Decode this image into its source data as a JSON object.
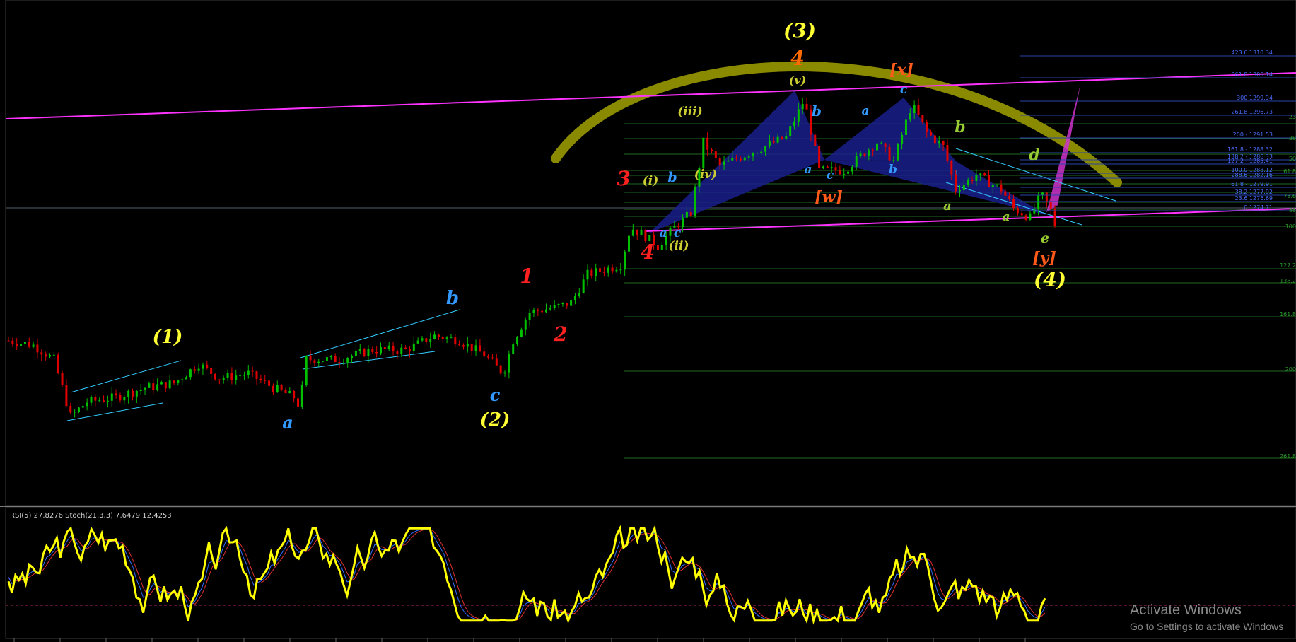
{
  "colors": {
    "background": "#000000",
    "bull_candle": "#00c000",
    "bear_candle": "#e00000",
    "channel_line": "#ff33ff",
    "arc": "#8a8a00",
    "pattern_fill": "#1a1f8c",
    "fib_line": "#2a44aa",
    "fib_text": "#4a6cff",
    "grid_green": "#1f6a1f",
    "rsi": "#ffff00",
    "stoch_main": "#2f6cff",
    "stoch_signal": "#e03030"
  },
  "indicator": {
    "label": "RSI(5) 27.8276  Stoch(21,3,3) 7.6479 12.4253"
  },
  "watermark": {
    "line1": "Activate Windows",
    "line2": "Go to Settings to activate Windows"
  },
  "wave_labels": [
    {
      "text": "(1)",
      "color": "#ffff33",
      "size": 26
    },
    {
      "text": "a",
      "color": "#3399ff",
      "size": 24
    },
    {
      "text": "b",
      "color": "#3399ff",
      "size": 26
    },
    {
      "text": "c",
      "color": "#3399ff",
      "size": 24
    },
    {
      "text": "(2)",
      "color": "#ffff33",
      "size": 26
    },
    {
      "text": "1",
      "color": "#ff2020",
      "size": 28
    },
    {
      "text": "2",
      "color": "#ff2020",
      "size": 28
    },
    {
      "text": "3",
      "color": "#ff2020",
      "size": 28
    },
    {
      "text": "4",
      "color": "#ff2020",
      "size": 28
    },
    {
      "text": "(i)",
      "color": "#cccc33",
      "size": 17
    },
    {
      "text": "(ii)",
      "color": "#cccc33",
      "size": 17
    },
    {
      "text": "(iii)",
      "color": "#cccc33",
      "size": 17
    },
    {
      "text": "(iv)",
      "color": "#cccc33",
      "size": 17
    },
    {
      "text": "(v)",
      "color": "#cccc33",
      "size": 16
    },
    {
      "text": "a",
      "color": "#3399ff",
      "size": 17
    },
    {
      "text": "b",
      "color": "#3399ff",
      "size": 19
    },
    {
      "text": "c",
      "color": "#3399ff",
      "size": 17
    },
    {
      "text": "(3)",
      "color": "#ffff33",
      "size": 28
    },
    {
      "text": "4",
      "color": "#ff6a00",
      "size": 28
    },
    {
      "text": "a",
      "color": "#3399ff",
      "size": 17
    },
    {
      "text": "b",
      "color": "#3399ff",
      "size": 20
    },
    {
      "text": "c",
      "color": "#3399ff",
      "size": 17
    },
    {
      "text": "[w]",
      "color": "#ff5a1a",
      "size": 22
    },
    {
      "text": "[x]",
      "color": "#ff5a1a",
      "size": 22
    },
    {
      "text": "a",
      "color": "#3399ff",
      "size": 17
    },
    {
      "text": "b",
      "color": "#3399ff",
      "size": 17
    },
    {
      "text": "c",
      "color": "#3399ff",
      "size": 17
    },
    {
      "text": "a",
      "color": "#99cc33",
      "size": 18
    },
    {
      "text": "b",
      "color": "#99cc33",
      "size": 22
    },
    {
      "text": "a",
      "color": "#99cc33",
      "size": 17
    },
    {
      "text": "d",
      "color": "#99cc33",
      "size": 22
    },
    {
      "text": "e",
      "color": "#99cc33",
      "size": 19
    },
    {
      "text": "[y]",
      "color": "#ff5a1a",
      "size": 22
    },
    {
      "text": "(4)",
      "color": "#ffff33",
      "size": 28
    }
  ],
  "fib_levels": [
    {
      "label": "423.6 1310.34"
    },
    {
      "label": "361.8 1305.14"
    },
    {
      "label": "300 1299.94"
    },
    {
      "label": "261.8 1296.73"
    },
    {
      "label": "200 - 1291.53"
    },
    {
      "label": "161.8 - 1288.32"
    },
    {
      "label": "138.2 - 1286.33"
    },
    {
      "label": "127.2 - 1285.41"
    },
    {
      "label": "100.0 1283.12"
    },
    {
      "label": "288.6 1282.16"
    },
    {
      "label": "61.8 - 1279.91"
    },
    {
      "label": "38.2 1277.92"
    },
    {
      "label": "23.6 1276.69"
    },
    {
      "label": "0 1274.71"
    }
  ],
  "right_edge_labels": [
    {
      "text": "23"
    },
    {
      "text": "38"
    },
    {
      "text": "50"
    },
    {
      "text": "61.8"
    },
    {
      "text": "78.6"
    },
    {
      "text": "88"
    },
    {
      "text": "100"
    },
    {
      "text": "127.2"
    },
    {
      "text": "138.2"
    },
    {
      "text": "161.8"
    },
    {
      "text": "200"
    },
    {
      "text": "261.8"
    }
  ],
  "chart_data": {
    "type": "candlestick",
    "price_path": [
      {
        "x": 0,
        "y": 1268.0
      },
      {
        "x": 30,
        "y": 1267.5
      },
      {
        "x": 55,
        "y": 1266.0
      },
      {
        "x": 75,
        "y": 1260.0
      },
      {
        "x": 95,
        "y": 1261.5
      },
      {
        "x": 130,
        "y": 1262.0
      },
      {
        "x": 165,
        "y": 1263.0
      },
      {
        "x": 200,
        "y": 1263.5
      },
      {
        "x": 230,
        "y": 1265.5
      },
      {
        "x": 255,
        "y": 1264.0
      },
      {
        "x": 290,
        "y": 1264.5
      },
      {
        "x": 320,
        "y": 1263.0
      },
      {
        "x": 345,
        "y": 1262.0
      },
      {
        "x": 352,
        "y": 1261.0
      },
      {
        "x": 360,
        "y": 1266.0
      },
      {
        "x": 400,
        "y": 1266.0
      },
      {
        "x": 440,
        "y": 1267.0
      },
      {
        "x": 480,
        "y": 1267.0
      },
      {
        "x": 515,
        "y": 1268.5
      },
      {
        "x": 545,
        "y": 1268.0
      },
      {
        "x": 575,
        "y": 1266.5
      },
      {
        "x": 598,
        "y": 1264.5
      },
      {
        "x": 610,
        "y": 1268.0
      },
      {
        "x": 630,
        "y": 1271.0
      },
      {
        "x": 660,
        "y": 1271.5
      },
      {
        "x": 680,
        "y": 1272.0
      },
      {
        "x": 700,
        "y": 1275.0
      },
      {
        "x": 740,
        "y": 1276.0
      },
      {
        "x": 752,
        "y": 1280.0
      },
      {
        "x": 770,
        "y": 1279.0
      },
      {
        "x": 785,
        "y": 1278.0
      },
      {
        "x": 805,
        "y": 1280.0
      },
      {
        "x": 825,
        "y": 1281.5
      },
      {
        "x": 840,
        "y": 1289.0
      },
      {
        "x": 860,
        "y": 1286.5
      },
      {
        "x": 900,
        "y": 1288.0
      },
      {
        "x": 940,
        "y": 1289.5
      },
      {
        "x": 962,
        "y": 1293.5
      },
      {
        "x": 980,
        "y": 1286.0
      },
      {
        "x": 1010,
        "y": 1286.0
      },
      {
        "x": 1050,
        "y": 1289.0
      },
      {
        "x": 1070,
        "y": 1287.0
      },
      {
        "x": 1092,
        "y": 1293.0
      },
      {
        "x": 1110,
        "y": 1290.0
      },
      {
        "x": 1130,
        "y": 1288.5
      },
      {
        "x": 1145,
        "y": 1284.0
      },
      {
        "x": 1170,
        "y": 1285.5
      },
      {
        "x": 1200,
        "y": 1284.0
      },
      {
        "x": 1215,
        "y": 1282.0
      },
      {
        "x": 1235,
        "y": 1281.0
      },
      {
        "x": 1248,
        "y": 1283.5
      },
      {
        "x": 1262,
        "y": 1281.5
      },
      {
        "x": 1268,
        "y": 1279.0
      }
    ],
    "candles_count": 210,
    "y_range": [
      1250,
      1300
    ],
    "fib_levels": [
      1310.34,
      1305.14,
      1299.94,
      1296.73,
      1291.53,
      1288.32,
      1286.33,
      1285.41,
      1283.12,
      1282.16,
      1279.91,
      1277.92,
      1276.69,
      1274.71
    ],
    "indicator": {
      "rsi_period": 5,
      "rsi_last": 27.8276,
      "stoch_params": [
        21,
        3,
        3
      ],
      "stoch_main_last": 7.6479,
      "stoch_signal_last": 12.4253
    }
  }
}
